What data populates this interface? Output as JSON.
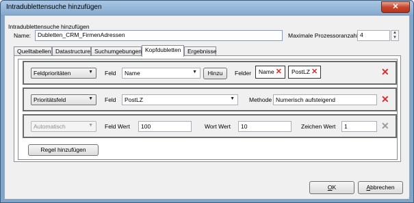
{
  "window": {
    "title": "Intradublettensuche hinzufügen",
    "close_glyph": "✕"
  },
  "group_label": "Intradublettensuche hinzufügen",
  "name": {
    "label": "Name:",
    "value": "Dubletten_CRM_FirmenAdressen"
  },
  "max_processes": {
    "label": "Maximale Prozessoranzahl",
    "value": "4"
  },
  "tabs": [
    {
      "label": "Quelltabellen",
      "active": false
    },
    {
      "label": "Datastructure",
      "active": false
    },
    {
      "label": "Suchumgebungen",
      "active": false
    },
    {
      "label": "Kopfdubletten",
      "active": true
    },
    {
      "label": "Ergebnisse",
      "active": false
    }
  ],
  "rules": [
    {
      "type": "Feldprioritäten",
      "field_label": "Feld",
      "field_value": "Name",
      "add_button": "Hinzu",
      "fields_label": "Felder",
      "fields": [
        "Name",
        "PostLZ"
      ]
    },
    {
      "type": "Prioritätsfeld",
      "field_label": "Feld",
      "field_value": "PostLZ",
      "method_label": "Methode",
      "method_value": "Numerisch aufsteigend"
    },
    {
      "type": "Automatisch",
      "field_value_label": "Feld Wert",
      "field_value": "100",
      "word_value_label": "Wort Wert",
      "word_value": "10",
      "char_value_label": "Zeichen Wert",
      "char_value": "1"
    }
  ],
  "add_rule_button": "Regel hinzufügen",
  "buttons": {
    "ok": "OK",
    "cancel": "Abbrechen"
  },
  "colors": {
    "delete": "#d92b2b",
    "titlebar": "#86abd0"
  }
}
